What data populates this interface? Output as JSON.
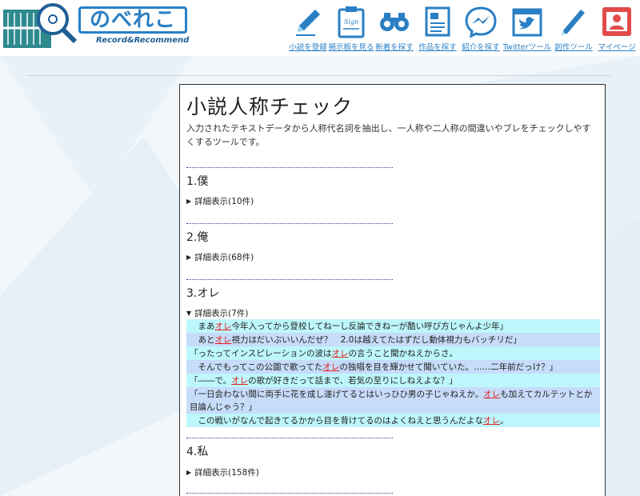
{
  "header": {
    "logo_text": "のべれこ",
    "logo_sub": "Record&Recommend",
    "nav": [
      {
        "label": "小説を登録",
        "icon": "pencil-icon"
      },
      {
        "label": "掲示板を見る",
        "icon": "clipboard-sign-icon"
      },
      {
        "label": "新着を探す",
        "icon": "binoculars-icon"
      },
      {
        "label": "作品を探す",
        "icon": "document-icon"
      },
      {
        "label": "紹介を探す",
        "icon": "messenger-icon"
      },
      {
        "label": "Twitterツール",
        "icon": "twitter-icon"
      },
      {
        "label": "創作ツール",
        "icon": "pen-icon"
      },
      {
        "label": "マイページ",
        "icon": "user-icon"
      }
    ]
  },
  "page": {
    "title": "小説人称チェック",
    "description": "入力されたテキストデータから人称代名詞を抽出し、一人称や二人称の間違いやブレをチェックしやすくするツールです。"
  },
  "sections": [
    {
      "title": "1.僕",
      "detail": "詳細表示(10件)"
    },
    {
      "title": "2.俺",
      "detail": "詳細表示(68件)"
    },
    {
      "title": "3.オレ",
      "detail": "詳細表示(7件)"
    },
    {
      "title": "4.私",
      "detail": "詳細表示(158件)"
    }
  ],
  "quotes": [
    {
      "pre": "　まあ",
      "hl": "オレ",
      "post": "今年入ってから登校してねーし反論できねーが酷い呼び方じゃんよ少年」"
    },
    {
      "pre": "　あと",
      "hl": "オレ",
      "post": "視力はだいぶいいんだぜ？　2.0は越えてたはずだし動体視力もバッチリだ」"
    },
    {
      "pre": "「ったってインスピレーションの波は",
      "hl": "オレ",
      "post": "の言うこと聞かねえからさ。"
    },
    {
      "pre": "　そんでもってこの公園で歌ってた",
      "hl": "オレ",
      "post": "の独唱を目を輝かせて聞いていた。……二年前だっけ？」"
    },
    {
      "pre": "「――で。",
      "hl": "オレ",
      "post": "の歌が好きだって話まで、若気の至りにしねえよな？」"
    },
    {
      "pre": "「一日会わない間に両手に花を成し遂げてるとはいっひひ男の子じゃねえか。",
      "hl": "オレ",
      "post": "も加えてカルテットとか目論んじゃう？」"
    },
    {
      "pre": "　この戦いがなんで起きてるかから目を背けてるのはよくねえと思うんだよな",
      "hl": "オレ",
      "post": "。"
    }
  ]
}
